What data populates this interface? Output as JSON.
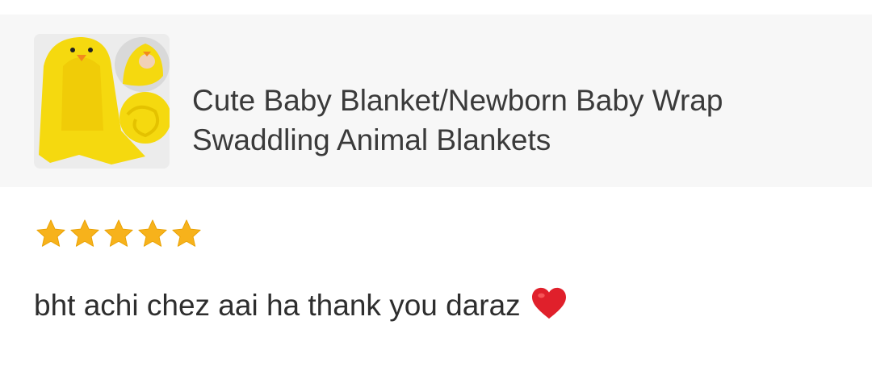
{
  "product": {
    "title": "Cute Baby Blanket/Newborn Baby Wrap Swaddling Animal Blankets",
    "thumbnail_icon": "duck-blanket-image"
  },
  "review": {
    "rating": 5,
    "rating_max": 5,
    "text": "bht achi chez aai ha thank you daraz",
    "emoji": "red-heart-icon"
  },
  "colors": {
    "star": "#f7b21b",
    "card_bg": "#f7f7f7",
    "heart": "#e0202b",
    "blanket_yellow": "#f5d90f"
  }
}
